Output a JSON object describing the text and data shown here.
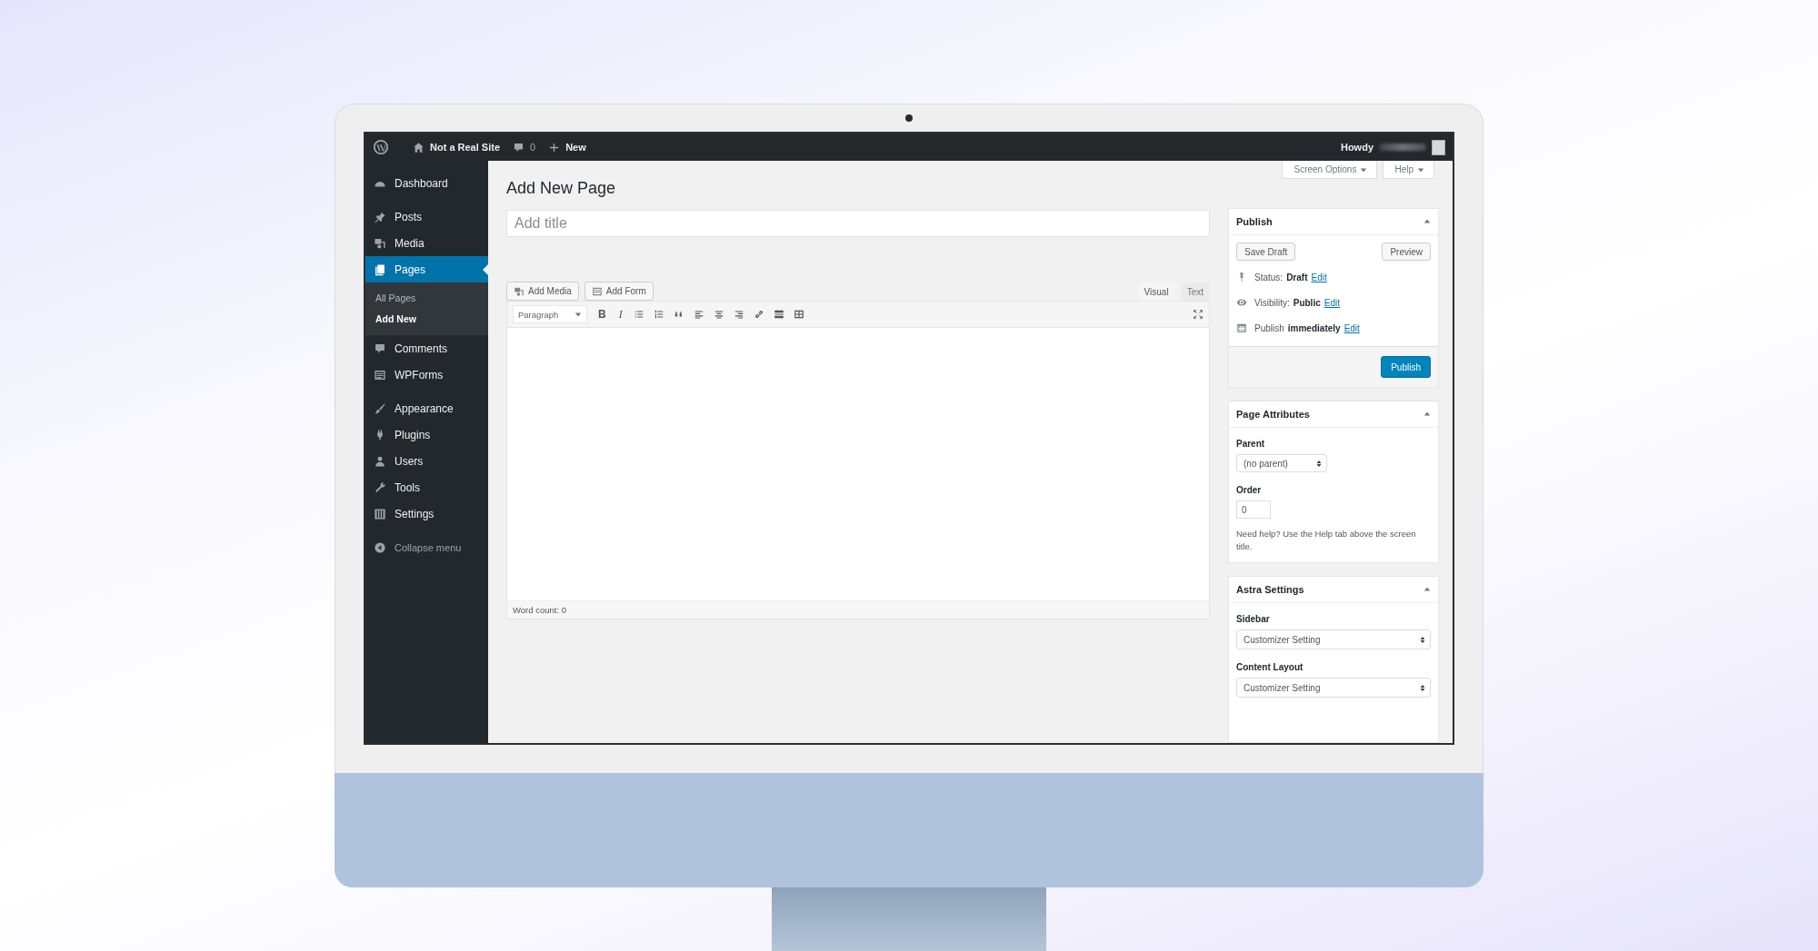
{
  "admin_bar": {
    "site_name": "Not a Real Site",
    "comment_count": "0",
    "new_label": "New",
    "greeting": "Howdy"
  },
  "sidebar": {
    "groups": [
      {
        "items": [
          {
            "label": "Dashboard",
            "selected": false
          }
        ]
      },
      {
        "items": [
          {
            "label": "Posts",
            "selected": false
          },
          {
            "label": "Media",
            "selected": false
          },
          {
            "label": "Pages",
            "selected": true,
            "children": [
              {
                "label": "All Pages",
                "selected": false
              },
              {
                "label": "Add New",
                "selected": true
              }
            ]
          },
          {
            "label": "Comments",
            "selected": false
          },
          {
            "label": "WPForms",
            "selected": false
          }
        ]
      },
      {
        "items": [
          {
            "label": "Appearance",
            "selected": false
          },
          {
            "label": "Plugins",
            "selected": false
          },
          {
            "label": "Users",
            "selected": false
          },
          {
            "label": "Tools",
            "selected": false
          },
          {
            "label": "Settings",
            "selected": false
          }
        ]
      }
    ],
    "collapse_label": "Collapse menu"
  },
  "screen_tabs": [
    "Screen Options",
    "Help"
  ],
  "page_title": "Add New Page",
  "title_field": {
    "placeholder": "Add title"
  },
  "media_buttons": [
    "Add Media",
    "Add Form"
  ],
  "editor_tabs": [
    {
      "label": "Visual",
      "selected": true
    },
    {
      "label": "Text",
      "selected": false
    }
  ],
  "toolbar": {
    "format": "Paragraph",
    "letter_buttons": [
      {
        "label": "B",
        "kind": "bold"
      },
      {
        "label": "I",
        "kind": "italic"
      }
    ]
  },
  "word_count": "Word count: 0",
  "publish_box": {
    "title": "Publish",
    "save_draft": "Save Draft",
    "preview": "Preview",
    "rows": [
      {
        "label": "Status:",
        "value": "Draft",
        "link": "Edit"
      },
      {
        "label": "Visibility:",
        "value": "Public",
        "link": "Edit"
      },
      {
        "label": "Publish",
        "value": "immediately",
        "link": "Edit"
      }
    ],
    "publish_button": "Publish"
  },
  "page_attributes": {
    "title": "Page Attributes",
    "parent_label": "Parent",
    "parent_value": "(no parent)",
    "order_label": "Order",
    "order_value": "0",
    "help": "Need help? Use the Help tab above the screen title."
  },
  "astra_settings": {
    "title": "Astra Settings",
    "fields": [
      {
        "label": "Sidebar",
        "value": "Customizer Setting"
      },
      {
        "label": "Content Layout",
        "value": "Customizer Setting"
      }
    ]
  }
}
